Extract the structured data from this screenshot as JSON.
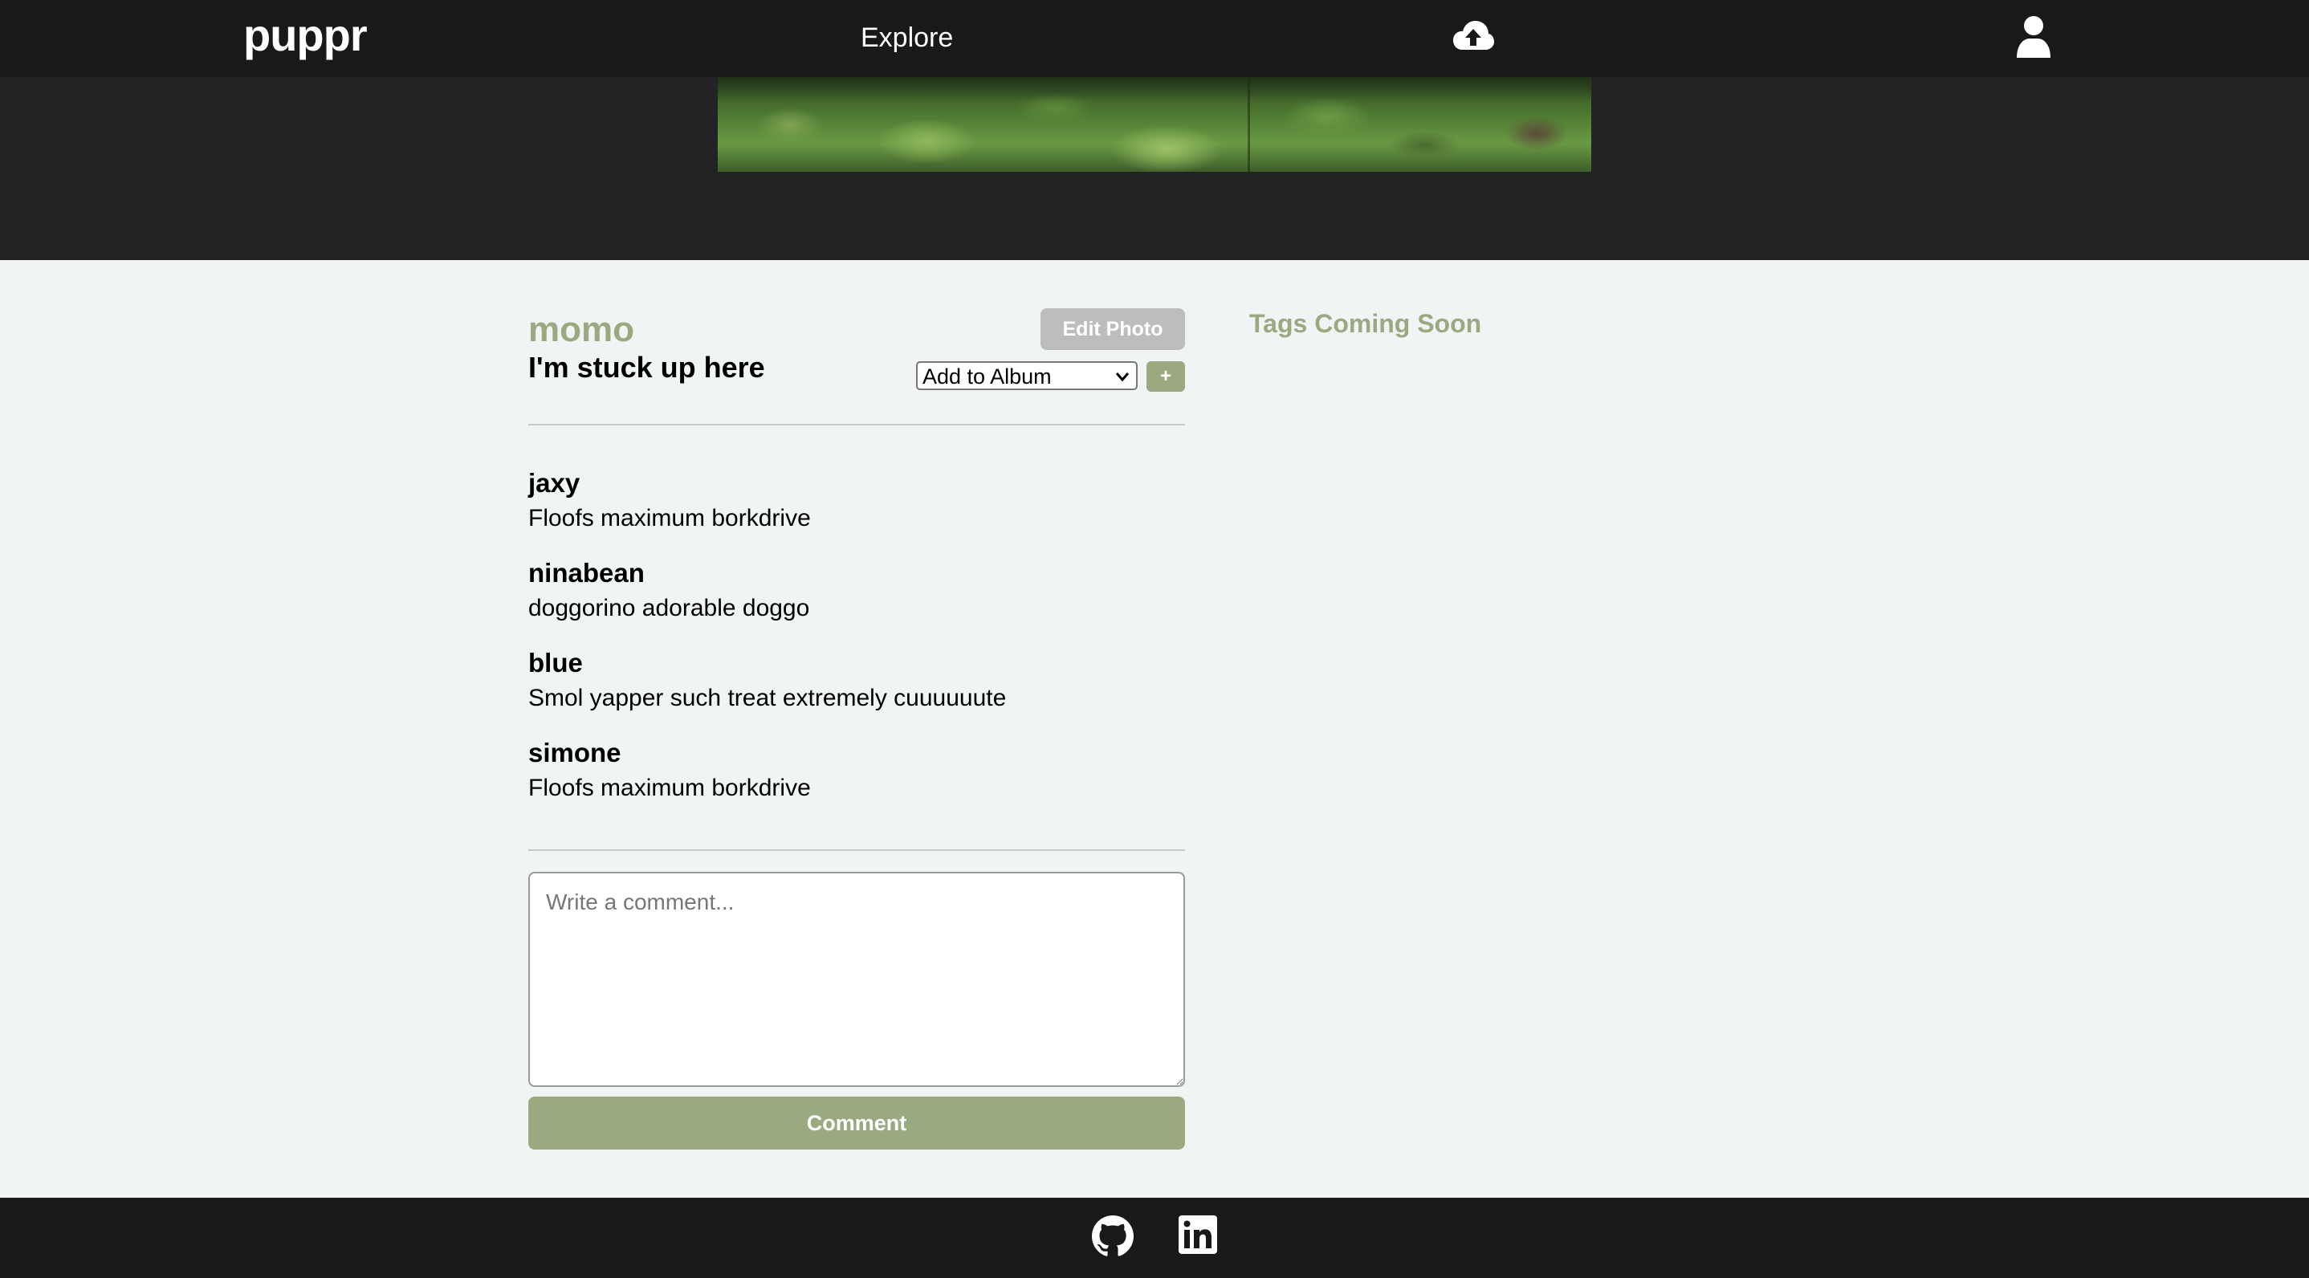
{
  "navbar": {
    "logo": "puppr",
    "explore_label": "Explore",
    "upload_icon": "cloud-upload-icon",
    "profile_icon": "user-icon"
  },
  "photo": {
    "author": "momo",
    "title": "I'm stuck up here",
    "edit_label": "Edit Photo",
    "album_select_value": "Add to Album",
    "add_album_label": "+"
  },
  "comments": [
    {
      "user": "jaxy",
      "text": "Floofs maximum borkdrive"
    },
    {
      "user": "ninabean",
      "text": "doggorino adorable doggo"
    },
    {
      "user": "blue",
      "text": "Smol yapper such treat extremely cuuuuuute"
    },
    {
      "user": "simone",
      "text": "Floofs maximum borkdrive"
    }
  ],
  "comment_form": {
    "placeholder": "Write a comment...",
    "submit_label": "Comment"
  },
  "tags": {
    "heading": "Tags Coming Soon"
  },
  "footer": {
    "github_icon": "github-icon",
    "linkedin_icon": "linkedin-icon"
  },
  "colors": {
    "accent": "#9aaa80",
    "navbar_bg": "#19191b",
    "hero_bg": "#232325",
    "page_bg": "#f0f4f4",
    "edit_button_bg": "#bdbdbd"
  }
}
